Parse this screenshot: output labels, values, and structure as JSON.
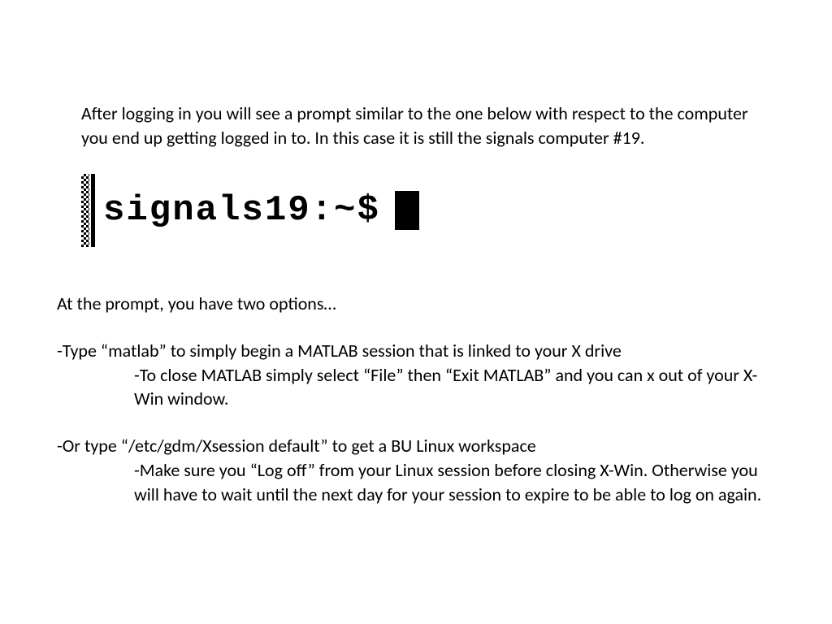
{
  "intro": "After logging in you will see a prompt similar to the one below with respect to the computer you end up getting logged in to. In this case it is still the signals computer #19.",
  "prompt": "signals19:~$",
  "options_intro": "At the prompt, you have two options…",
  "opt1": "-Type “matlab” to simply begin a MATLAB session that is linked to your X drive",
  "opt1_sub": "-To close MATLAB simply select “File” then “Exit MATLAB” and you can x out of your X-Win window.",
  "opt2": "-Or type “/etc/gdm/Xsession default” to get a BU Linux workspace",
  "opt2_sub": "-Make sure you “Log off” from your Linux session before closing X-Win. Otherwise you will have to wait until the next day for your session to expire to be able to log on again."
}
